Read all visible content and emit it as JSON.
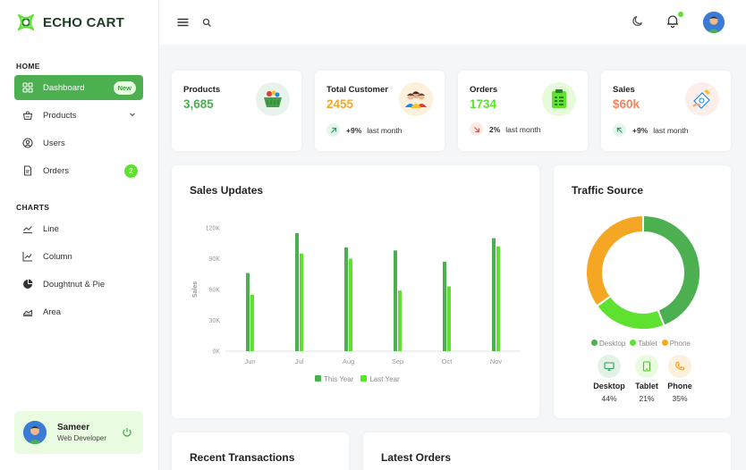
{
  "brand": {
    "name": "ECHO CART"
  },
  "sidebar": {
    "home_label": "HOME",
    "charts_label": "CHARTS",
    "home_items": [
      {
        "label": "Dashboard",
        "icon": "dashboard-icon",
        "badge": "New",
        "active": true
      },
      {
        "label": "Products",
        "icon": "basket-icon"
      },
      {
        "label": "Users",
        "icon": "user-circle-icon"
      },
      {
        "label": "Orders",
        "icon": "document-icon",
        "badge": "2"
      }
    ],
    "chart_items": [
      {
        "label": "Line",
        "icon": "line-chart-icon"
      },
      {
        "label": "Column",
        "icon": "column-chart-icon"
      },
      {
        "label": "Doughtnut & Pie",
        "icon": "pie-chart-icon"
      },
      {
        "label": "Area",
        "icon": "area-chart-icon"
      }
    ],
    "profile": {
      "name": "Sameer",
      "role": "Web Developer"
    }
  },
  "stats": [
    {
      "title": "Products",
      "value": "3,685",
      "color": "#4caf50",
      "icon_bg": "#e8f3ec",
      "icon": "basket-icon"
    },
    {
      "title": "Total Customer",
      "value": "2455",
      "color": "#f5a623",
      "icon_bg": "#fdf0dc",
      "icon": "customers-icon",
      "trend": "+9%",
      "trend_label": "last month",
      "trend_dir": "up"
    },
    {
      "title": "Orders",
      "value": "1734",
      "color": "#5ee12f",
      "icon_bg": "#e6fbd9",
      "icon": "clipboard-icon",
      "trend": "2%",
      "trend_label": "last month",
      "trend_dir": "down"
    },
    {
      "title": "Sales",
      "value": "$60k",
      "color": "#f4845f",
      "icon_bg": "#fdeeea",
      "icon": "money-icon",
      "trend": "+9%",
      "trend_label": "last month",
      "trend_dir": "up"
    }
  ],
  "sales": {
    "title": "Sales Updates",
    "legend": [
      "This Year",
      "Last Year"
    ]
  },
  "traffic": {
    "title": "Traffic Source",
    "devices": [
      {
        "name": "Desktop",
        "pct": "44%",
        "color": "#4caf50",
        "bg": "#e2f3e5",
        "icon": "desktop-icon"
      },
      {
        "name": "Tablet",
        "pct": "21%",
        "color": "#5ee12f",
        "bg": "#e8fbdf",
        "icon": "tablet-icon"
      },
      {
        "name": "Phone",
        "pct": "35%",
        "color": "#f5a623",
        "bg": "#fdf0dc",
        "icon": "phone-icon"
      }
    ]
  },
  "bottom": {
    "transactions_title": "Recent Transactions",
    "orders_title": "Latest Orders"
  },
  "chart_data": [
    {
      "type": "bar",
      "title": "Sales Updates",
      "xlabel": "",
      "ylabel": "Sales",
      "categories": [
        "Jun",
        "Jul",
        "Aug",
        "Sep",
        "Oct",
        "Nov"
      ],
      "ylim": [
        0,
        120000
      ],
      "yticks": [
        "0K",
        "30K",
        "60K",
        "90K",
        "120K"
      ],
      "yticks_values": [
        0,
        30000,
        60000,
        90000,
        120000
      ],
      "series": [
        {
          "name": "This Year",
          "color": "#4caf50",
          "values": [
            76000,
            115000,
            101000,
            98000,
            87000,
            110000
          ]
        },
        {
          "name": "Last Year",
          "color": "#5ee12f",
          "values": [
            55000,
            95000,
            90000,
            59000,
            63000,
            102000
          ]
        }
      ]
    },
    {
      "type": "pie",
      "title": "Traffic Source",
      "categories": [
        "Desktop",
        "Tablet",
        "Phone"
      ],
      "values": [
        44,
        21,
        35
      ],
      "colors": [
        "#4caf50",
        "#5ee12f",
        "#f5a623"
      ]
    }
  ]
}
